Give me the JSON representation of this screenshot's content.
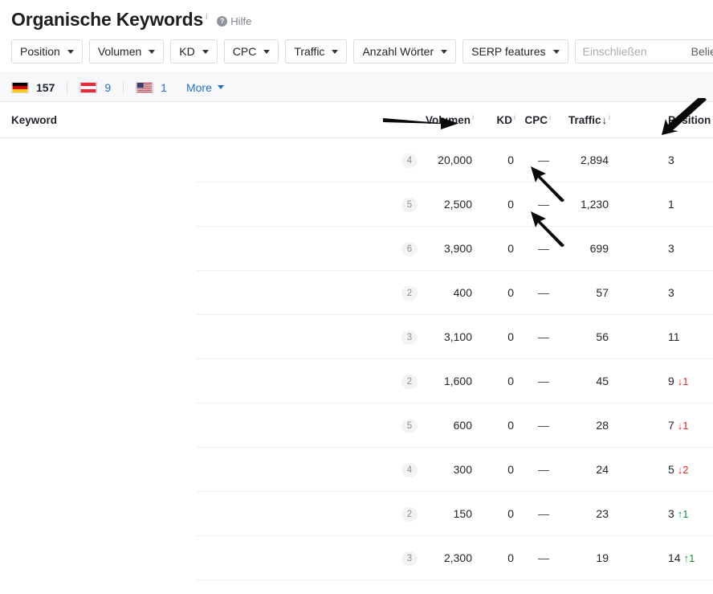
{
  "header": {
    "title": "Organische Keywords",
    "title_superscript": "i",
    "help_label": "Hilfe",
    "help_icon": "question-circle-icon"
  },
  "filters": {
    "buttons": [
      {
        "label": "Position"
      },
      {
        "label": "Volumen"
      },
      {
        "label": "KD"
      },
      {
        "label": "CPC"
      },
      {
        "label": "Traffic"
      },
      {
        "label": "Anzahl Wörter"
      },
      {
        "label": "SERP features"
      }
    ],
    "include": {
      "value": "",
      "placeholder": "Einschließen",
      "mode_label": "Beliebig"
    }
  },
  "countries": {
    "items": [
      {
        "flag": "de",
        "count": "157",
        "active": true
      },
      {
        "flag": "at",
        "count": "9",
        "active": false
      },
      {
        "flag": "us",
        "count": "1",
        "active": false
      }
    ],
    "more_label": "More"
  },
  "table": {
    "columns": [
      {
        "key": "keyword",
        "label": "Keyword",
        "info": false,
        "sorted": false
      },
      {
        "key": "words",
        "label": "",
        "info": false,
        "sorted": false
      },
      {
        "key": "volumen",
        "label": "Volumen",
        "info": true,
        "sorted": false
      },
      {
        "key": "kd",
        "label": "KD",
        "info": true,
        "sorted": false
      },
      {
        "key": "cpc",
        "label": "CPC",
        "info": true,
        "sorted": false
      },
      {
        "key": "traffic",
        "label": "Traffic",
        "info": true,
        "sorted": true,
        "sort_dir": "desc",
        "sort_glyph": "↓"
      },
      {
        "key": "position",
        "label": "Position",
        "info": true,
        "sorted": false
      }
    ],
    "info_glyph": "i",
    "rows": [
      {
        "keyword": "",
        "words": "4",
        "volumen": "20,000",
        "kd": "0",
        "cpc": "—",
        "traffic": "2,894",
        "position": "3",
        "delta": "",
        "delta_dir": ""
      },
      {
        "keyword": "",
        "words": "5",
        "volumen": "2,500",
        "kd": "0",
        "cpc": "—",
        "traffic": "1,230",
        "position": "1",
        "delta": "",
        "delta_dir": ""
      },
      {
        "keyword": "",
        "words": "6",
        "volumen": "3,900",
        "kd": "0",
        "cpc": "—",
        "traffic": "699",
        "position": "3",
        "delta": "",
        "delta_dir": ""
      },
      {
        "keyword": "",
        "words": "2",
        "volumen": "400",
        "kd": "0",
        "cpc": "—",
        "traffic": "57",
        "position": "3",
        "delta": "",
        "delta_dir": ""
      },
      {
        "keyword": "",
        "words": "3",
        "volumen": "3,100",
        "kd": "0",
        "cpc": "—",
        "traffic": "56",
        "position": "11",
        "delta": "",
        "delta_dir": ""
      },
      {
        "keyword": "",
        "words": "2",
        "volumen": "1,600",
        "kd": "0",
        "cpc": "—",
        "traffic": "45",
        "position": "9",
        "delta": "1",
        "delta_dir": "down"
      },
      {
        "keyword": "",
        "words": "5",
        "volumen": "600",
        "kd": "0",
        "cpc": "—",
        "traffic": "28",
        "position": "7",
        "delta": "1",
        "delta_dir": "down"
      },
      {
        "keyword": "",
        "words": "4",
        "volumen": "300",
        "kd": "0",
        "cpc": "—",
        "traffic": "24",
        "position": "5",
        "delta": "2",
        "delta_dir": "down"
      },
      {
        "keyword": "",
        "words": "2",
        "volumen": "150",
        "kd": "0",
        "cpc": "—",
        "traffic": "23",
        "position": "3",
        "delta": "1",
        "delta_dir": "up"
      },
      {
        "keyword": "",
        "words": "3",
        "volumen": "2,300",
        "kd": "0",
        "cpc": "—",
        "traffic": "19",
        "position": "14",
        "delta": "1",
        "delta_dir": "up"
      }
    ],
    "delta_glyphs": {
      "up": "↑",
      "down": "↓"
    }
  },
  "annotations": [
    {
      "name": "arrow-to-volumen-header",
      "direction": "right"
    },
    {
      "name": "arrow-to-position-header",
      "direction": "down-left"
    },
    {
      "name": "arrow-to-kd-row-1",
      "direction": "up-left"
    },
    {
      "name": "arrow-to-kd-row-2",
      "direction": "up-left"
    }
  ],
  "colors": {
    "link": "#1f6fd0",
    "delta_up": "#13923c",
    "delta_down": "#e52727",
    "band_bg": "#f7f8f9",
    "border": "#e6e8ea"
  }
}
